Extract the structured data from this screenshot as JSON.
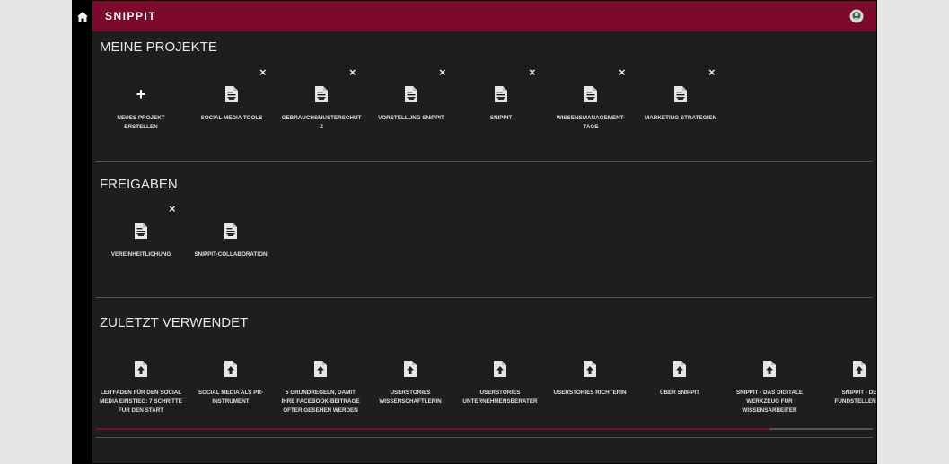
{
  "app": {
    "brand": "SNIPPIT"
  },
  "sections": {
    "projects": {
      "title": "MEINE PROJEKTE",
      "new_label": "NEUES PROJEKT ERSTELLEN",
      "items": [
        "SOCIAL MEDIA TOOLS",
        "GEBRAUCHSMUSTERSCHUTZ",
        "VORSTELLUNG SNIPPIT",
        "SNIPPIT",
        "WISSENSMANAGEMENT-TAGE",
        "MARKETING STRATEGIEN"
      ]
    },
    "shares": {
      "title": "FREIGABEN",
      "items": [
        "VEREINHEITLICHUNG",
        "SNIPPIT-COLLABORATION"
      ]
    },
    "recent": {
      "title": "ZULETZT VERWENDET",
      "items": [
        "LEITFADEN FÜR DEN SOCIAL MEDIA EINSTIEG: 7 SCHRITTE FÜR DEN START",
        "SOCIAL MEDIA ALS PR-INSTRUMENT",
        "5 GRUNDREGELN, DAMIT IHRE FACEBOOK-BEITRÄGE ÖFTER GESEHEN WERDEN",
        "USERSTORIES WISSENSCHAFTLERIN",
        "USERSTORIES UNTERNEHMENSBERATER",
        "USERSTORIES RICHTERIN",
        "ÜBER SNIPPIT",
        "SNIPPIT - DAS DIGITALE WERKZEUG FÜR WISSENSARBEITER",
        "SNIPPIT - DE FUNDSTELLENSA"
      ]
    }
  },
  "icons": {
    "home": "home-icon",
    "user": "user-avatar-icon",
    "delete": "×",
    "plus": "+"
  },
  "colors": {
    "brand": "#7b0a2d",
    "background": "#1e1e1e",
    "sidebar": "#000000"
  }
}
